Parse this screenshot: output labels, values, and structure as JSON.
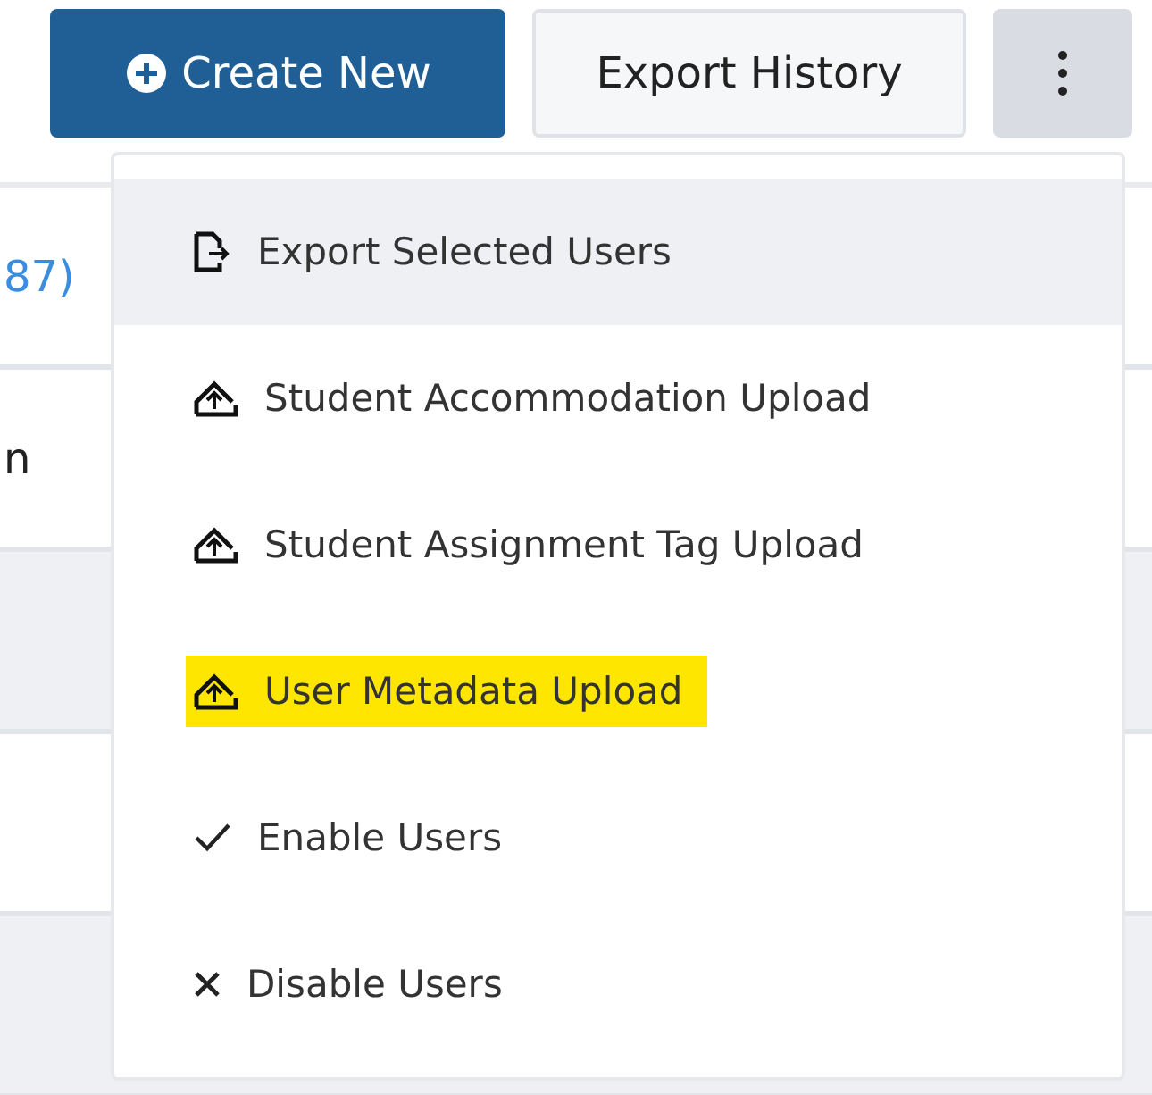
{
  "toolbar": {
    "create_button": "Create New",
    "export_history_button": "Export History"
  },
  "table_rows": [
    {
      "text": "87)",
      "kind": "link",
      "shaded": false
    },
    {
      "text": "n",
      "kind": "plain",
      "shaded": false
    },
    {
      "shaded": true
    },
    {
      "shaded": false
    },
    {
      "shaded": true
    }
  ],
  "menu": [
    {
      "label": "Export Selected Users",
      "kind": "export",
      "hovered": true,
      "highlighted": false
    },
    {
      "label": "Student Accommodation Upload",
      "kind": "upload",
      "hovered": false,
      "highlighted": false
    },
    {
      "label": "Student Assignment Tag Upload",
      "kind": "upload",
      "hovered": false,
      "highlighted": false
    },
    {
      "label": "User Metadata Upload",
      "kind": "upload",
      "hovered": false,
      "highlighted": true
    },
    {
      "label": "Enable Users",
      "kind": "check",
      "hovered": false,
      "highlighted": false
    },
    {
      "label": "Disable Users",
      "kind": "close",
      "hovered": false,
      "highlighted": false
    }
  ]
}
